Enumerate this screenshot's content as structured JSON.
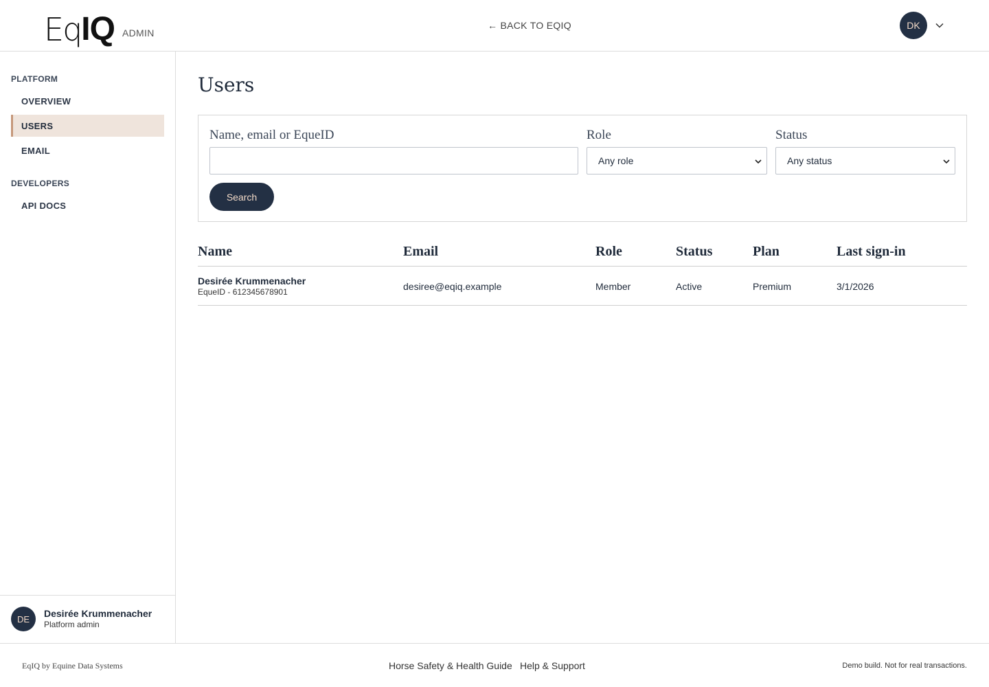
{
  "header": {
    "logo_eq": "Eq",
    "logo_iq": "IQ",
    "logo_suffix": "ADMIN",
    "back_link": "← BACK TO EQIQ",
    "avatar_initials": "DK"
  },
  "sidebar": {
    "sections": [
      {
        "heading": "PLATFORM"
      },
      {
        "heading": "DEVELOPERS"
      }
    ],
    "items": [
      {
        "label": "OVERVIEW",
        "active": false
      },
      {
        "label": "USERS",
        "active": true
      },
      {
        "label": "EMAIL",
        "active": false
      },
      {
        "label": "API DOCS",
        "active": false
      }
    ],
    "user": {
      "initials": "DE",
      "name": "Desirée Krummenacher",
      "role": "Platform admin"
    }
  },
  "main": {
    "title": "Users",
    "filters": {
      "query_label": "Name, email or EqueID",
      "query_value": "",
      "role_label": "Role",
      "role_value": "Any role",
      "status_label": "Status",
      "status_value": "Any status",
      "search_button": "Search"
    },
    "table": {
      "columns": [
        "Name",
        "Email",
        "Role",
        "Status",
        "Plan",
        "Last sign-in"
      ],
      "rows": [
        {
          "name": "Desirée Krummenacher",
          "equeid": "EqueID - 612345678901",
          "email": "desiree@eqiq.example",
          "role": "Member",
          "status": "Active",
          "plan": "Premium",
          "last_sign_in": "3/1/2026"
        }
      ]
    }
  },
  "footer": {
    "left": "EqIQ by Equine Data Systems",
    "links": [
      "Horse Safety & Health Guide",
      "Help & Support"
    ],
    "right": "Demo build. Not for real transactions."
  },
  "colors": {
    "navy": "#233044",
    "accent": "#c5977a",
    "active_bg": "#efe4dc"
  }
}
